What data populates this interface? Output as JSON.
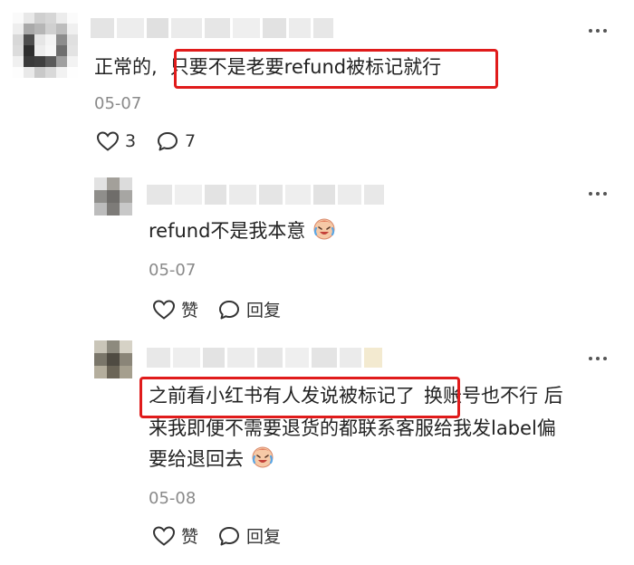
{
  "comments": [
    {
      "text_prefix": "正常的,",
      "text_highlight": "只要不是老要refund被标记就行",
      "date": "05-07",
      "like_count": "3",
      "reply_count": "7",
      "replies": [
        {
          "text": "refund不是我本意",
          "date": "05-07",
          "like_label": "赞",
          "reply_label": "回复"
        },
        {
          "text_highlight": "之前看小红书有人发说被标记了",
          "text_rest_line1": "换账号也不行 后",
          "text_line2": "来我即便不需要退货的都联系客服给我发label偏",
          "text_line3": "要给退回去",
          "date": "05-08",
          "like_label": "赞",
          "reply_label": "回复"
        }
      ]
    }
  ],
  "icons": {
    "heart": "heart-icon",
    "comment": "comment-bubble-icon",
    "more": "more-dots-icon",
    "emoji": "crying-laughing-emoji-icon"
  },
  "colors": {
    "highlight_border": "#e01b1b",
    "date": "#8a8a8a",
    "text": "#222222"
  }
}
